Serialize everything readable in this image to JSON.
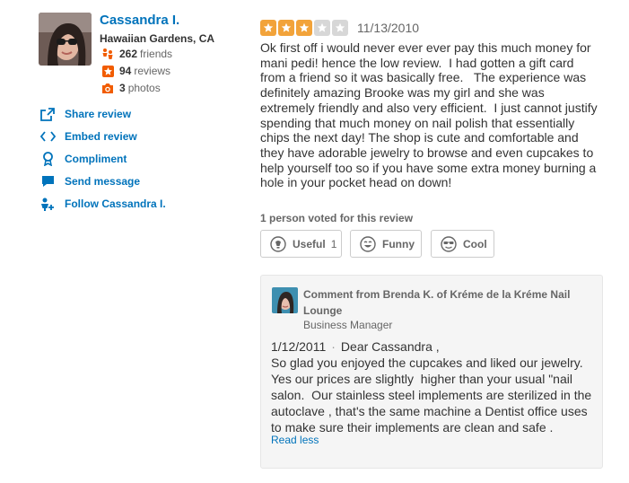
{
  "user": {
    "name": "Cassandra I.",
    "location": "Hawaiian Gardens, CA",
    "friends_count": "262",
    "friends_label": "friends",
    "reviews_count": "94",
    "reviews_label": "reviews",
    "photos_count": "3",
    "photos_label": "photos"
  },
  "actions": [
    {
      "label": "Share review",
      "icon": "share-icon"
    },
    {
      "label": "Embed review",
      "icon": "embed-icon"
    },
    {
      "label": "Compliment",
      "icon": "compliment-icon"
    },
    {
      "label": "Send message",
      "icon": "message-icon"
    },
    {
      "label": "Follow Cassandra I.",
      "icon": "follow-icon"
    }
  ],
  "review": {
    "rating": 3,
    "rating_max": 5,
    "date": "11/13/2010",
    "text": "Ok first off i would never ever ever pay this much money for mani pedi! hence the low review.  I had gotten a gift card from a friend so it was basically free.   The experience was definitely amazing Brooke was my girl and she was extremely friendly and also very efficient.  I just cannot justify spending that much money on nail polish that essentially chips the next day! The shop is cute and comfortable and they have adorable jewelry to browse and even cupcakes to help yourself too so if you have some extra money burning a hole in your pocket head on down!"
  },
  "votes": {
    "summary": "1 person voted for this review",
    "useful_label": "Useful",
    "useful_count": "1",
    "funny_label": "Funny",
    "cool_label": "Cool"
  },
  "comment": {
    "from": "Comment from Brenda K. of Kréme de la Kréme Nail Lounge",
    "role": "Business Manager",
    "date": "1/12/2011",
    "separator": "·",
    "text": "Dear Cassandra ,\nSo glad you enjoyed the cupcakes and liked our jewelry. Yes our prices are slightly  higher than your usual \"nail salon.  Our stainless steel implements are sterilized in the autoclave , that's the same machine a Dentist office uses to make sure their implements are clean and safe .",
    "read_less": "Read less"
  },
  "colors": {
    "link": "#0073bb",
    "star_on": "#f2a33a",
    "star_off": "#d7d7d7",
    "friends_icon": "#f15c00",
    "reviews_icon": "#f15c00"
  }
}
